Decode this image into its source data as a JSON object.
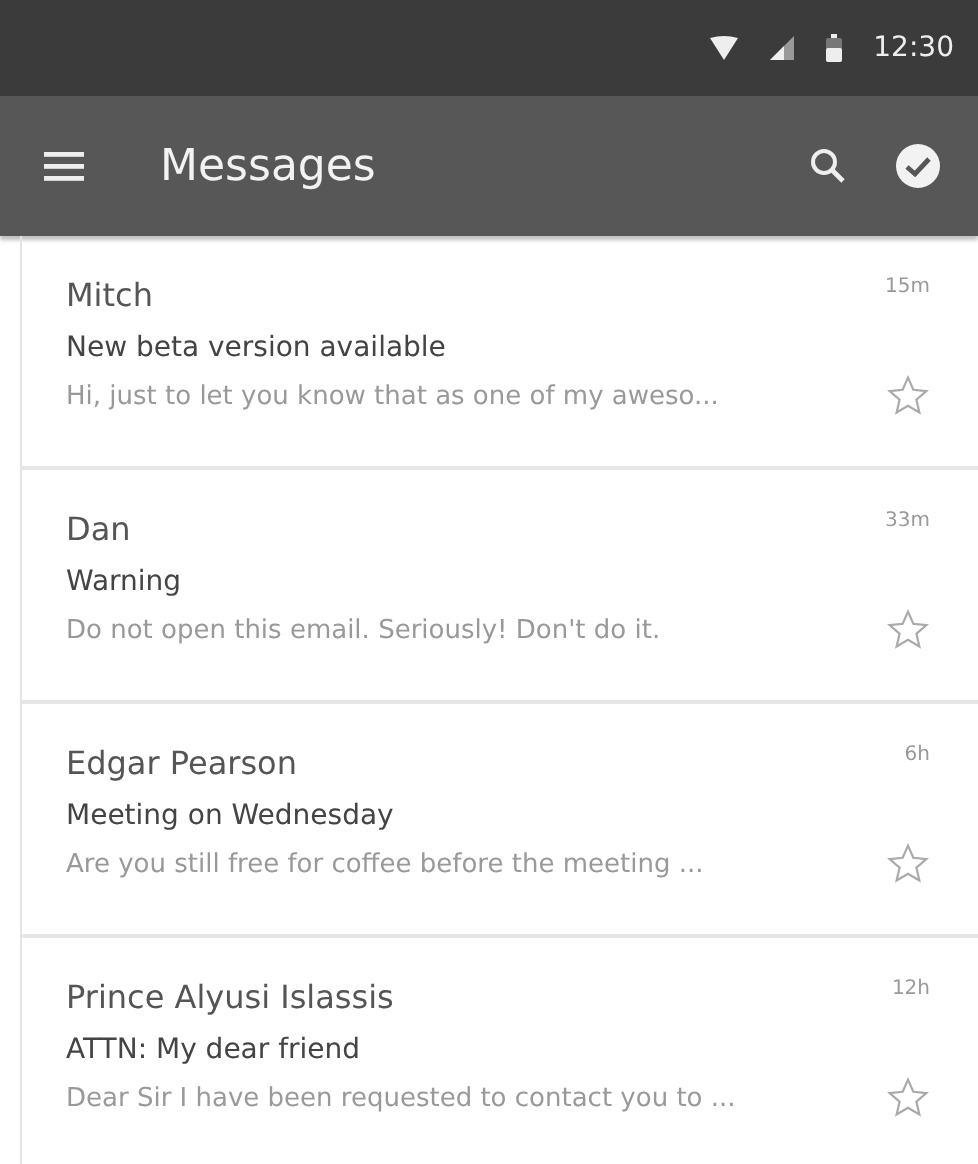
{
  "status_bar": {
    "time": "12:30"
  },
  "toolbar": {
    "title": "Messages"
  },
  "messages": [
    {
      "sender": "Mitch",
      "time": "15m",
      "subject": "New beta version available",
      "preview": "Hi, just to let you know that as one of my aweso...",
      "starred": false
    },
    {
      "sender": "Dan",
      "time": "33m",
      "subject": "Warning",
      "preview": "Do not open this email. Seriously! Don't do it.",
      "starred": false
    },
    {
      "sender": "Edgar Pearson",
      "time": "6h",
      "subject": "Meeting on Wednesday",
      "preview": "Are you still free for coffee before the meeting ...",
      "starred": false
    },
    {
      "sender": "Prince Alyusi Islassis",
      "time": "12h",
      "subject": "ATTN: My dear friend",
      "preview": "Dear Sir I have been requested to contact you to ...",
      "starred": false
    }
  ]
}
